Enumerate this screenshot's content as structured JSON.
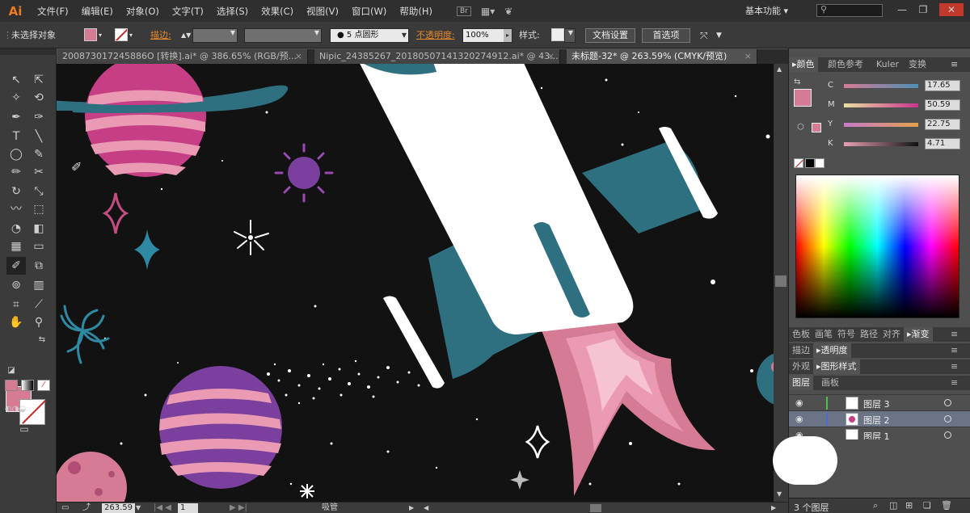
{
  "app": {
    "logo": "Ai"
  },
  "menu": [
    "文件(F)",
    "编辑(E)",
    "对象(O)",
    "文字(T)",
    "选择(S)",
    "效果(C)",
    "视图(V)",
    "窗口(W)",
    "帮助(H)"
  ],
  "menu_icons": {
    "bridge": "Br",
    "arrange": "arrange-documents-icon",
    "gpu": "gpu-performance-icon"
  },
  "workspace": "基本功能",
  "search": {
    "placeholder": "",
    "icon": "search-icon"
  },
  "window_controls": [
    "—",
    "❐",
    "✕"
  ],
  "controlbar": {
    "selection_label": "未选择对象",
    "stroke_label": "描边:",
    "brush": "5 点圆形",
    "opacity_label": "不透明度:",
    "opacity_value": "100%",
    "style_label": "样式:",
    "doc_settings": "文档设置",
    "preferences": "首选项",
    "fill_color": "#d57b93"
  },
  "tabs": [
    {
      "label": "200873017245886O [转换].ai* @ 386.65% (RGB/预...",
      "close": "×"
    },
    {
      "label": "Nipic_24385267_20180507141320274912.ai* @ 43...",
      "close": "×"
    },
    {
      "label": "未标题-32* @ 263.59% (CMYK/预览)",
      "close": "×"
    }
  ],
  "color_panel": {
    "tabs": [
      "颜色",
      "颜色参考",
      "Kuler",
      "变换"
    ],
    "channels": [
      {
        "name": "C",
        "value": "17.65"
      },
      {
        "name": "M",
        "value": "50.59"
      },
      {
        "name": "Y",
        "value": "22.75"
      },
      {
        "name": "K",
        "value": "4.71"
      }
    ],
    "fill_color": "#d57b93"
  },
  "panel_tabs_row2": [
    "色板",
    "画笔",
    "符号",
    "路径",
    "对齐",
    "渐变"
  ],
  "panel_tabs_row3": [
    "描边",
    "透明度"
  ],
  "panel_tabs_row4": [
    "外观",
    "图形样式"
  ],
  "layers_tabs": [
    "图层",
    "画板"
  ],
  "layers": [
    {
      "name": "图层 3",
      "color": "#4ac24a"
    },
    {
      "name": "图层 2",
      "color": "#4a6ad6"
    },
    {
      "name": "图层 1",
      "color": "#d64a4a"
    }
  ],
  "layers_footer": "3 个图层",
  "statusbar": {
    "zoom": "263.59",
    "page": "1",
    "tool": "吸管"
  },
  "colors": {
    "canvas_bg": "#121212",
    "pink": "#d57b93",
    "teal": "#2e6f80",
    "purple": "#7b3f9e",
    "magenta": "#c63f86"
  }
}
